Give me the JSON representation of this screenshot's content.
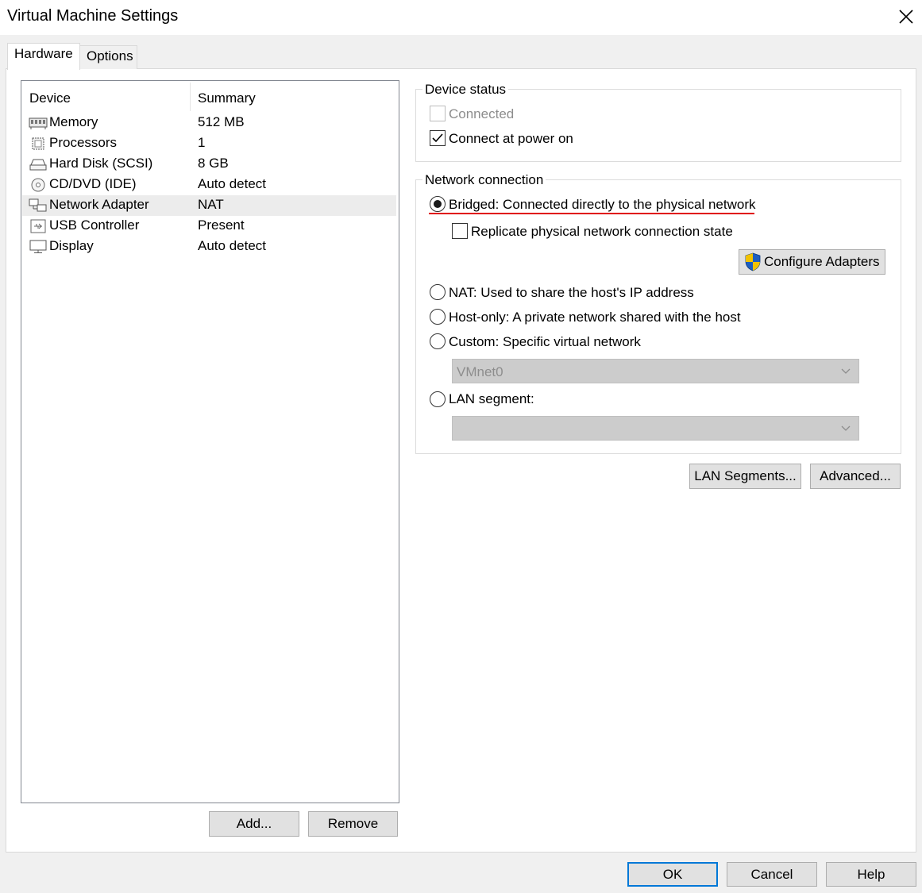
{
  "window": {
    "title": "Virtual Machine Settings"
  },
  "tabs": [
    {
      "label": "Hardware"
    },
    {
      "label": "Options"
    }
  ],
  "device_list": {
    "columns": {
      "device": "Device",
      "summary": "Summary"
    },
    "rows": [
      {
        "name": "Memory",
        "summary": "512 MB",
        "icon": "memory-icon"
      },
      {
        "name": "Processors",
        "summary": "1",
        "icon": "processor-icon"
      },
      {
        "name": "Hard Disk (SCSI)",
        "summary": "8 GB",
        "icon": "hard-disk-icon"
      },
      {
        "name": "CD/DVD (IDE)",
        "summary": "Auto detect",
        "icon": "cd-dvd-icon"
      },
      {
        "name": "Network Adapter",
        "summary": "NAT",
        "icon": "network-adapter-icon",
        "selected": true
      },
      {
        "name": "USB Controller",
        "summary": "Present",
        "icon": "usb-icon"
      },
      {
        "name": "Display",
        "summary": "Auto detect",
        "icon": "display-icon"
      }
    ]
  },
  "list_buttons": {
    "add": "Add...",
    "remove": "Remove"
  },
  "device_status": {
    "label": "Device status",
    "connected": {
      "label": "Connected",
      "checked": false,
      "enabled": false
    },
    "connect_at_power_on": {
      "label": "Connect at power on",
      "checked": true
    }
  },
  "network_connection": {
    "label": "Network connection",
    "bridged": {
      "label": "Bridged: Connected directly to the physical network",
      "selected": true
    },
    "replicate": {
      "label": "Replicate physical network connection state",
      "checked": false
    },
    "configure_adapters": "Configure Adapters",
    "nat": {
      "label": "NAT: Used to share the host's IP address",
      "selected": false
    },
    "host_only": {
      "label": "Host-only: A private network shared with the host",
      "selected": false
    },
    "custom": {
      "label": "Custom: Specific virtual network",
      "selected": false,
      "value": "VMnet0"
    },
    "lan_segment": {
      "label": "LAN segment:",
      "selected": false,
      "value": ""
    }
  },
  "network_buttons": {
    "lan_segments": "LAN Segments...",
    "advanced": "Advanced..."
  },
  "dialog_buttons": {
    "ok": "OK",
    "cancel": "Cancel",
    "help": "Help"
  },
  "colors": {
    "annotation_underline": "#e00000",
    "default_button_border": "#0078d7"
  }
}
